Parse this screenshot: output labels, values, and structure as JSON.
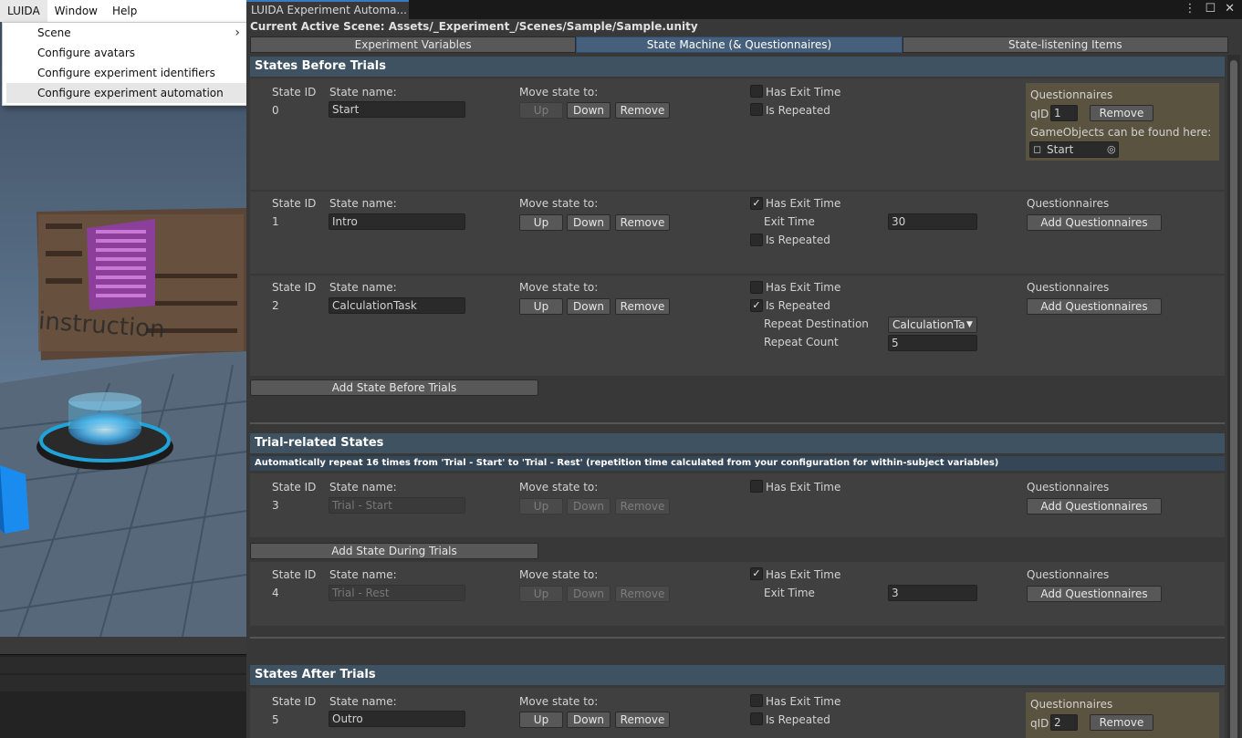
{
  "menubar": {
    "items": [
      "LUIDA",
      "Window",
      "Help"
    ]
  },
  "dropdown": {
    "items": [
      "Scene",
      "Configure avatars",
      "Configure experiment identifiers",
      "Configure experiment automation"
    ]
  },
  "scene": {
    "sign_text": "instruction"
  },
  "window": {
    "tab_title": "LUIDA Experiment Automa...",
    "active_scene": "Current Active Scene: Assets/_Experiment_/Scenes/Sample/Sample.unity",
    "tabs": [
      "Experiment Variables",
      "State Machine (& Questionnaires)",
      "State-listening Items"
    ]
  },
  "labels": {
    "state_id": "State ID",
    "state_name": "State name:",
    "move": "Move state to:",
    "up": "Up",
    "down": "Down",
    "remove": "Remove",
    "has_exit_time": "Has Exit Time",
    "is_repeated": "Is Repeated",
    "exit_time": "Exit Time",
    "repeat_destination": "Repeat Destination",
    "repeat_count": "Repeat Count",
    "questionnaires": "Questionnaires",
    "add_questionnaires": "Add Questionnaires",
    "qid": "qID",
    "go_found": "GameObjects can be found here:"
  },
  "sections": {
    "before": "States Before Trials",
    "trial": "Trial-related States",
    "trial_note": "Automatically repeat 16 times from 'Trial - Start' to 'Trial - Rest' (repetition time calculated from your configuration for within-subject variables)",
    "after": "States After Trials",
    "add_before": "Add State Before Trials",
    "add_during": "Add State During Trials"
  },
  "states": {
    "s0": {
      "id": "0",
      "name": "Start",
      "qid": "1",
      "go": "Start"
    },
    "s1": {
      "id": "1",
      "name": "Intro",
      "exit_time": "30"
    },
    "s2": {
      "id": "2",
      "name": "CalculationTask",
      "repeat_destination": "CalculationTa",
      "repeat_count": "5"
    },
    "s3": {
      "id": "3",
      "name": "Trial - Start"
    },
    "s4": {
      "id": "4",
      "name": "Trial - Rest",
      "exit_time": "3"
    },
    "s5": {
      "id": "5",
      "name": "Outro",
      "qid": "2"
    }
  },
  "colors": {
    "accent": "#46607c",
    "section_header": "#3e5262",
    "questionnaire_box": "#5a533f"
  }
}
